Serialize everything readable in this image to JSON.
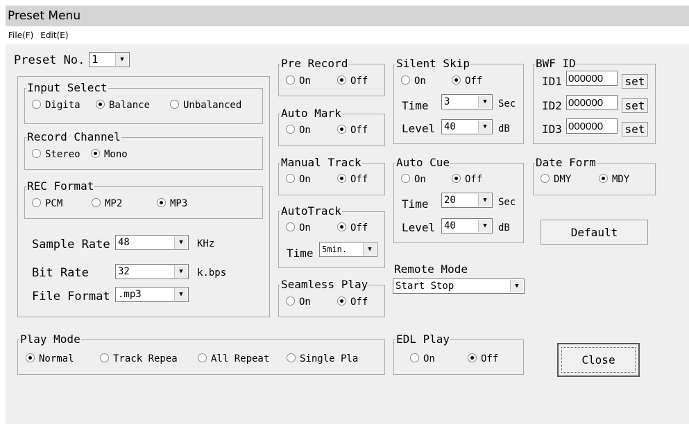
{
  "window": {
    "title": "Preset Menu"
  },
  "menu": {
    "file": "File(F)",
    "edit": "Edit(E)"
  },
  "preset": {
    "label": "Preset No.",
    "value": "1"
  },
  "input_select": {
    "legend": "Input Select",
    "options": [
      "Digita",
      "Balance",
      "Unbalanced"
    ],
    "selected": "Balance"
  },
  "record_channel": {
    "legend": "Record Channel",
    "options": [
      "Stereo",
      "Mono"
    ],
    "selected": "Mono"
  },
  "rec_format": {
    "legend": "REC Format",
    "options": [
      "PCM",
      "MP2",
      "MP3"
    ],
    "selected": "MP3",
    "sample_rate": {
      "label": "Sample Rate",
      "value": "48",
      "unit": "KHz"
    },
    "bit_rate": {
      "label": "Bit Rate",
      "value": "32",
      "unit": "k.bps"
    },
    "file_format": {
      "label": "File Format",
      "value": ".mp3"
    }
  },
  "pre_record": {
    "legend": "Pre Record",
    "on": "On",
    "off": "Off",
    "selected": "Off"
  },
  "auto_mark": {
    "legend": "Auto Mark",
    "on": "On",
    "off": "Off",
    "selected": "Off"
  },
  "manual_track": {
    "legend": "Manual Track",
    "on": "On",
    "off": "Off",
    "selected": "Off"
  },
  "auto_track": {
    "legend": "AutoTrack",
    "on": "On",
    "off": "Off",
    "selected": "Off",
    "time_label": "Time",
    "time_value": "5min."
  },
  "seamless_play": {
    "legend": "Seamless Play",
    "on": "On",
    "off": "Off",
    "selected": "Off"
  },
  "silent_skip": {
    "legend": "Silent Skip",
    "on": "On",
    "off": "Off",
    "selected": "Off",
    "time_label": "Time",
    "time_value": "3",
    "time_unit": "Sec",
    "level_label": "Level",
    "level_value": "40",
    "level_unit": "dB"
  },
  "auto_cue": {
    "legend": "Auto Cue",
    "on": "On",
    "off": "Off",
    "selected": "Off",
    "time_label": "Time",
    "time_value": "20",
    "time_unit": "Sec",
    "level_label": "Level",
    "level_value": "40",
    "level_unit": "dB"
  },
  "remote_mode": {
    "label": "Remote Mode",
    "value": "Start Stop"
  },
  "bwf_id": {
    "legend": "BWF ID",
    "rows": [
      {
        "label": "ID1",
        "value": "000000",
        "button": "set"
      },
      {
        "label": "ID2",
        "value": "000000",
        "button": "set"
      },
      {
        "label": "ID3",
        "value": "000000",
        "button": "set"
      }
    ]
  },
  "date_form": {
    "legend": "Date Form",
    "options": [
      "DMY",
      "MDY"
    ],
    "selected": "MDY"
  },
  "default_button": "Default",
  "play_mode": {
    "legend": "Play Mode",
    "options": [
      "Normal",
      "Track Repea",
      "All Repeat",
      "Single Pla"
    ],
    "selected": "Normal"
  },
  "edl_play": {
    "legend": "EDL Play",
    "on": "On",
    "off": "Off",
    "selected": "Off"
  },
  "close_button": "Close"
}
